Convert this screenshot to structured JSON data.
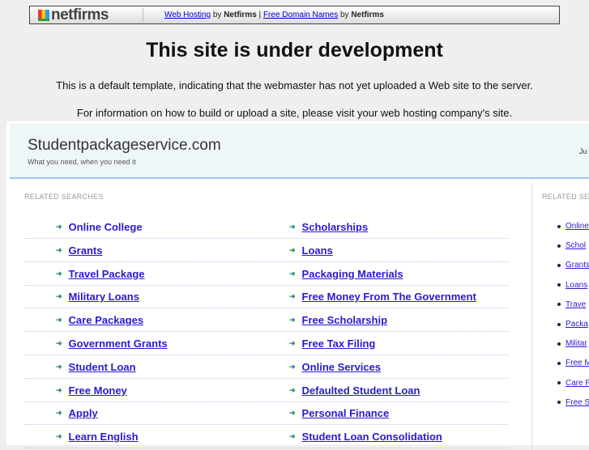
{
  "topbar": {
    "logo": "netfirms",
    "link1": "Web Hosting",
    "by1": " by ",
    "brand1": "Netfirms",
    "sep": " | ",
    "link2": "Free Domain Names",
    "by2": " by ",
    "brand2": "Netfirms"
  },
  "title": "This site is under development",
  "info1": "This is a default template, indicating that the webmaster has not yet uploaded a Web site to the server.",
  "info2": "For information on how to build or upload a site, please visit your web hosting company's site.",
  "site": {
    "name": "Studentpackageservice.com",
    "tagline": "What you need, when you need it",
    "right_text": "Ju"
  },
  "related_label": "RELATED SEARCHES",
  "related_label_right": "RELATED SE",
  "left_col": [
    "Online College",
    "Grants",
    "Travel Package",
    "Military Loans",
    "Care Packages",
    "Government Grants",
    "Student Loan",
    "Free Money",
    "Apply",
    "Learn English"
  ],
  "mid_col": [
    "Scholarships",
    "Loans",
    "Packaging Materials",
    "Free Money From The Government",
    "Free Scholarship",
    "Free Tax Filing",
    "Online Services",
    "Defaulted Student Loan",
    "Personal Finance",
    "Student Loan Consolidation"
  ],
  "right_col": [
    "Online",
    "Schol",
    "Grants",
    "Loans",
    "Trave",
    "Packa",
    "Militar",
    "Free M",
    "Care P",
    "Free S"
  ]
}
